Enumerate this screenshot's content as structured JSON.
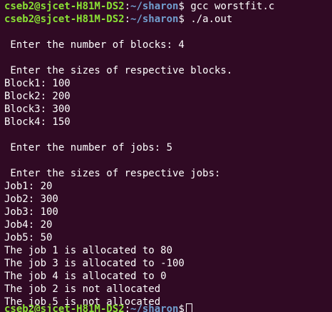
{
  "prompt": {
    "user_host": "cseb2@sjcet-H81M-DS2",
    "separator": ":",
    "path": "~/sharon",
    "symbol": "$"
  },
  "commands": [
    "gcc worstfit.c",
    "./a.out"
  ],
  "output": [
    "",
    " Enter the number of blocks: 4",
    "",
    " Enter the sizes of respective blocks.",
    "Block1: 100",
    "Block2: 200",
    "Block3: 300",
    "Block4: 150",
    "",
    " Enter the number of jobs: 5",
    "",
    " Enter the sizes of respective jobs:",
    "Job1: 20",
    "Job2: 300",
    "Job3: 100",
    "Job4: 20",
    "Job5: 50",
    "The job 1 is allocated to 80",
    "The job 3 is allocated to -100",
    "The job 4 is allocated to 0",
    "The job 2 is not allocated",
    "The job 5 is not allocated"
  ],
  "colors": {
    "background": "#300a24",
    "user_host": "#8ae234",
    "path": "#729fcf",
    "text": "#ffffff"
  }
}
